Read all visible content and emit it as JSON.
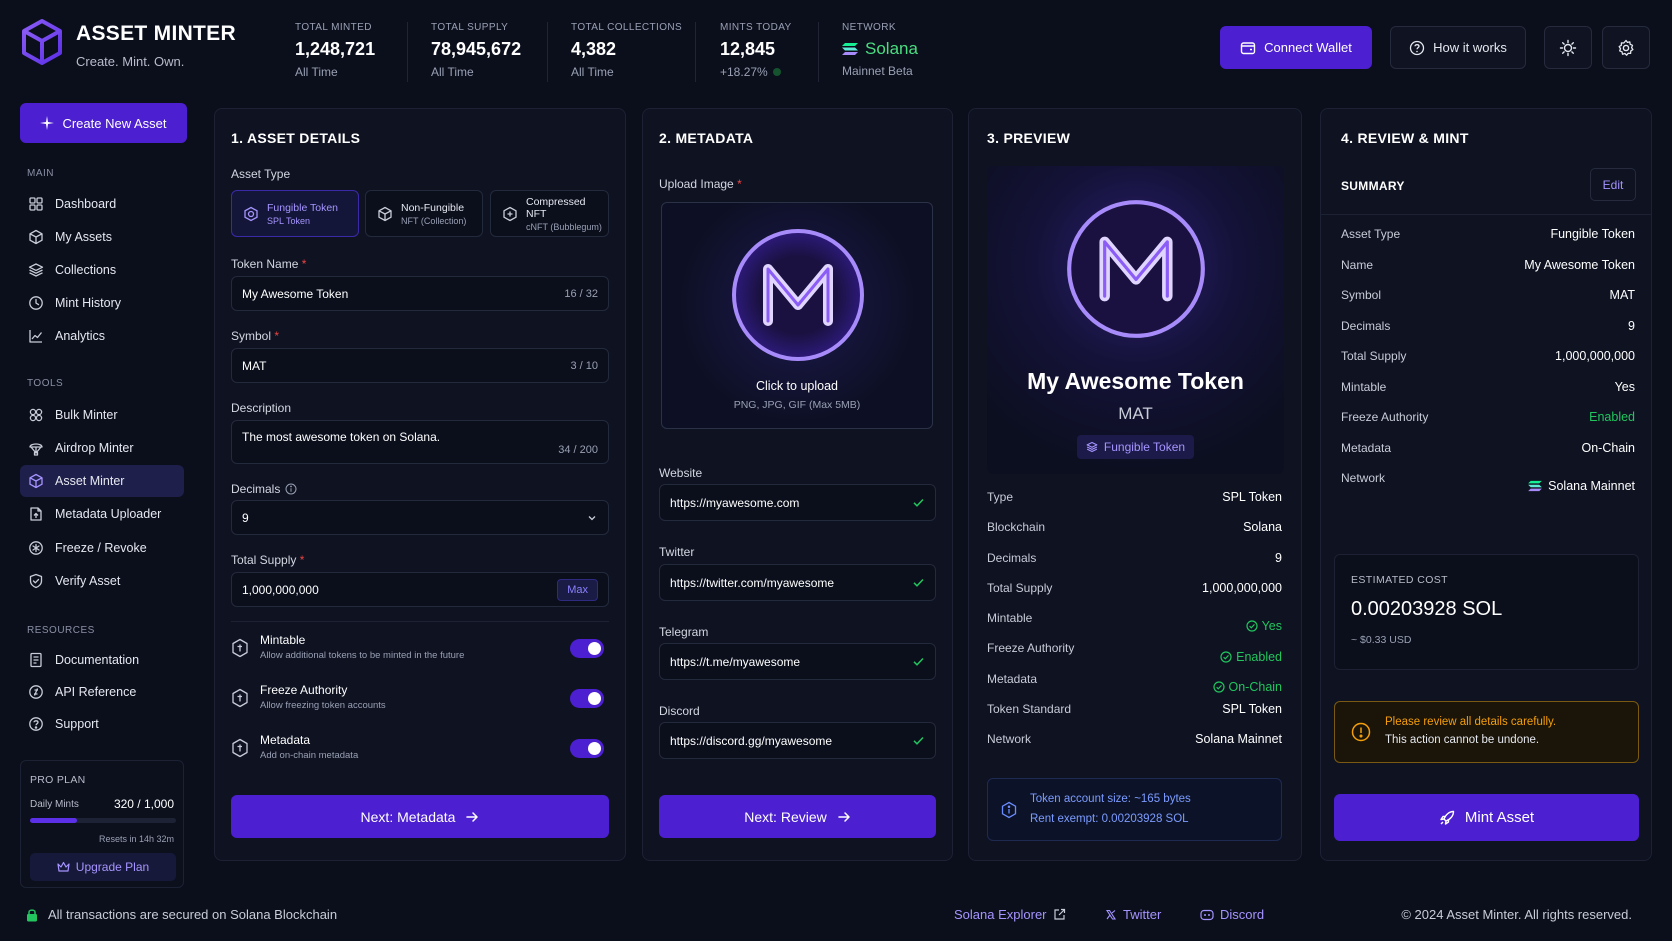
{
  "app": {
    "title": "ASSET MINTER",
    "tagline": "Create. Mint. Own."
  },
  "stats": [
    {
      "label": "TOTAL MINTED",
      "value": "1,248,721",
      "sub": "All Time"
    },
    {
      "label": "TOTAL SUPPLY",
      "value": "78,945,672",
      "sub": "All Time"
    },
    {
      "label": "TOTAL COLLECTIONS",
      "value": "4,382",
      "sub": "All Time"
    },
    {
      "label": "MINTS TODAY",
      "value": "12,845",
      "sub": "+18.27%"
    },
    {
      "label": "NETWORK",
      "value": "Solana",
      "sub": "Mainnet Beta"
    }
  ],
  "header": {
    "connect_wallet": "Connect Wallet",
    "how_it_works": "How it works"
  },
  "sidebar": {
    "create_button": "Create New Asset",
    "main_label": "MAIN",
    "main_items": [
      {
        "label": "Dashboard",
        "icon": "grid-icon"
      },
      {
        "label": "My Assets",
        "icon": "cube-icon"
      },
      {
        "label": "Collections",
        "icon": "layers-icon"
      },
      {
        "label": "Mint History",
        "icon": "clock-icon"
      },
      {
        "label": "Analytics",
        "icon": "chart-icon"
      }
    ],
    "tools_label": "TOOLS",
    "tools_items": [
      {
        "label": "Bulk Minter",
        "icon": "bulk-icon"
      },
      {
        "label": "Airdrop Minter",
        "icon": "airdrop-icon"
      },
      {
        "label": "Asset Minter",
        "icon": "cube-icon",
        "active": true
      },
      {
        "label": "Metadata Uploader",
        "icon": "upload-icon"
      },
      {
        "label": "Freeze / Revoke",
        "icon": "freeze-icon"
      },
      {
        "label": "Verify Asset",
        "icon": "shield-check-icon"
      }
    ],
    "resources_label": "RESOURCES",
    "resources_items": [
      {
        "label": "Documentation",
        "icon": "doc-icon"
      },
      {
        "label": "API Reference",
        "icon": "api-icon"
      },
      {
        "label": "Support",
        "icon": "help-icon"
      }
    ],
    "plan": {
      "title": "PRO PLAN",
      "daily_label": "Daily Mints",
      "daily_value": "320 / 1,000",
      "progress": 0.32,
      "resets": "Resets in 14h 32m",
      "upgrade": "Upgrade Plan"
    }
  },
  "details": {
    "title": "1. ASSET DETAILS",
    "asset_type_label": "Asset Type",
    "types": [
      {
        "title": "Fungible Token",
        "sub": "SPL Token",
        "selected": true
      },
      {
        "title": "Non-Fungible",
        "sub": "NFT (Collection)"
      },
      {
        "title": "Compressed NFT",
        "sub": "cNFT (Bubblegum)"
      }
    ],
    "token_name_label": "Token Name",
    "token_name": "My Awesome Token",
    "token_name_count": "16 / 32",
    "symbol_label": "Symbol",
    "symbol": "MAT",
    "symbol_count": "3 / 10",
    "description_label": "Description",
    "description": "The most awesome token on Solana.",
    "description_count": "34 / 200",
    "decimals_label": "Decimals",
    "decimals": "9",
    "supply_label": "Total Supply",
    "supply": "1,000,000,000",
    "max_label": "Max",
    "toggles": [
      {
        "title": "Mintable",
        "desc": "Allow additional tokens to be minted in the future",
        "on": true
      },
      {
        "title": "Freeze Authority",
        "desc": "Allow freezing token accounts",
        "on": true
      },
      {
        "title": "Metadata",
        "desc": "Add on-chain metadata",
        "on": true
      }
    ],
    "next": "Next: Metadata"
  },
  "metadata": {
    "title": "2. METADATA",
    "upload_label": "Upload Image",
    "click_upload": "Click to upload",
    "formats": "PNG, JPG, GIF (Max 5MB)",
    "website_label": "Website",
    "website": "https://myawesome.com",
    "twitter_label": "Twitter",
    "twitter": "https://twitter.com/myawesome",
    "telegram_label": "Telegram",
    "telegram": "https://t.me/myawesome",
    "discord_label": "Discord",
    "discord": "https://discord.gg/myawesome",
    "next": "Next: Review"
  },
  "preview": {
    "title": "3. PREVIEW",
    "token_name": "My Awesome Token",
    "symbol": "MAT",
    "badge": "Fungible Token",
    "rows": [
      {
        "label": "Type",
        "value": "SPL Token"
      },
      {
        "label": "Blockchain",
        "value": "Solana"
      },
      {
        "label": "Decimals",
        "value": "9"
      },
      {
        "label": "Total Supply",
        "value": "1,000,000,000"
      },
      {
        "label": "Mintable",
        "value": "Yes",
        "status": true
      },
      {
        "label": "Freeze Authority",
        "value": "Enabled",
        "status": true
      },
      {
        "label": "Metadata",
        "value": "On-Chain",
        "status": true
      },
      {
        "label": "Token Standard",
        "value": "SPL Token"
      },
      {
        "label": "Network",
        "value": "Solana Mainnet"
      }
    ],
    "info_line1": "Token account size: ~165 bytes",
    "info_line2": "Rent exempt: 0.00203928 SOL"
  },
  "review": {
    "title": "4. REVIEW & MINT",
    "summary_label": "SUMMARY",
    "edit": "Edit",
    "rows": [
      {
        "label": "Asset Type",
        "value": "Fungible Token"
      },
      {
        "label": "Name",
        "value": "My Awesome Token"
      },
      {
        "label": "Symbol",
        "value": "MAT"
      },
      {
        "label": "Decimals",
        "value": "9"
      },
      {
        "label": "Total Supply",
        "value": "1,000,000,000"
      },
      {
        "label": "Mintable",
        "value": "Yes"
      },
      {
        "label": "Freeze Authority",
        "value": "Enabled",
        "green": true
      },
      {
        "label": "Metadata",
        "value": "On-Chain"
      },
      {
        "label": "Network",
        "value": "Solana Mainnet",
        "solana": true
      }
    ],
    "cost_label": "ESTIMATED COST",
    "cost_value": "0.00203928 SOL",
    "cost_usd": "~ $0.33 USD",
    "warn_line1": "Please review all details carefully.",
    "warn_line2": "This action cannot be undone.",
    "mint": "Mint Asset"
  },
  "footer": {
    "secure": "All transactions are secured on Solana Blockchain",
    "explorer": "Solana Explorer",
    "twitter": "Twitter",
    "discord": "Discord",
    "copyright": "© 2024 Asset Minter. All rights reserved."
  },
  "colors": {
    "accent": "#4c1fd1",
    "background": "#0b0f1c",
    "success": "#22c55e",
    "warning": "#f59e0b",
    "solana": "#14f195"
  }
}
